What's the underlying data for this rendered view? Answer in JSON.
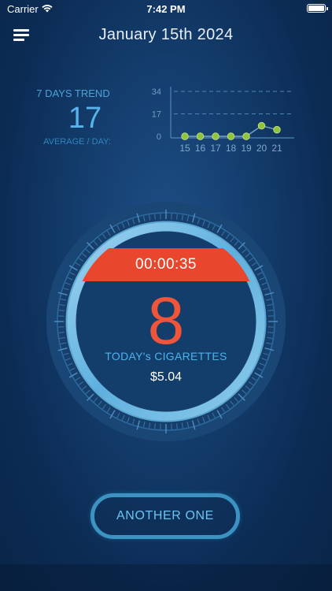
{
  "status_bar": {
    "carrier": "Carrier",
    "time": "7:42 PM"
  },
  "header": {
    "title": "January 15th 2024",
    "menu_icon": "hamburger-menu-icon"
  },
  "trend": {
    "label": "7 DAYS TREND",
    "value": "17",
    "sublabel": "AVERAGE / DAY:"
  },
  "chart_data": {
    "type": "line",
    "categories": [
      "15",
      "16",
      "17",
      "18",
      "19",
      "20",
      "21"
    ],
    "values": [
      0,
      0,
      0,
      0,
      0,
      8,
      5
    ],
    "yticks": [
      "0",
      "17",
      "34"
    ],
    "ylim": [
      0,
      34
    ],
    "gridlines": "dashed at 17 and 34",
    "line_color": "#7fa6c7",
    "point_color": "#8fc43a"
  },
  "counter": {
    "timer": "00:00:35",
    "count": "8",
    "label": "TODAY's CIGARETTES",
    "cost": "$5.04"
  },
  "actions": {
    "another_one": "ANOTHER ONE"
  },
  "colors": {
    "accent_blue": "#4cb2ee",
    "timer_red": "#e8472d",
    "count_orange": "#f0553a",
    "ring_light": "#7fc4e8"
  }
}
